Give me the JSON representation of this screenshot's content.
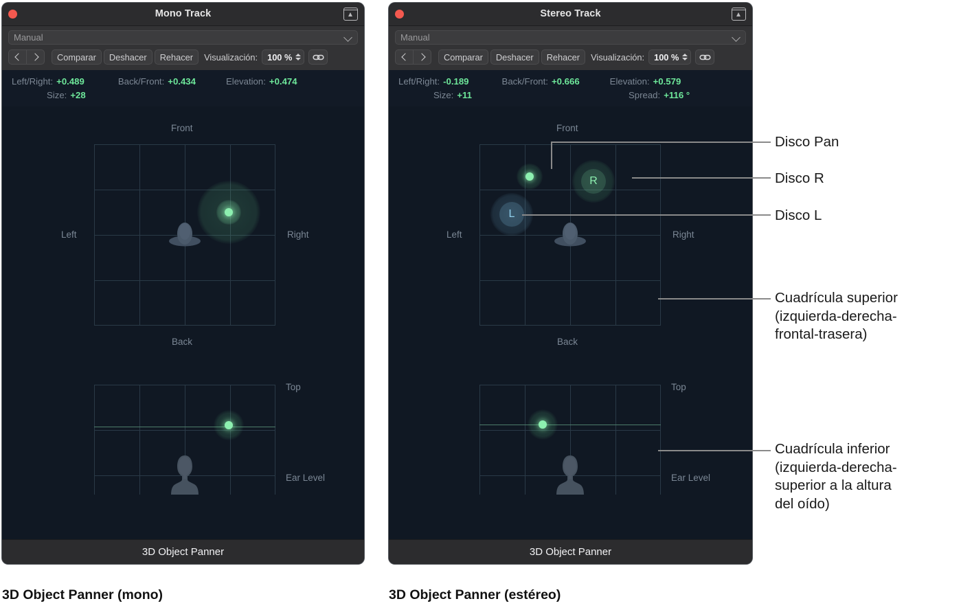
{
  "mono": {
    "title": "Mono Track",
    "preset": "Manual",
    "toolbar": {
      "prev": "‹",
      "next": "›",
      "compare": "Comparar",
      "undo": "Deshacer",
      "redo": "Rehacer",
      "view_label": "Visualización:",
      "zoom_value": "100 %",
      "link_icon": "link-icon"
    },
    "readout": {
      "left_right_label": "Left/Right:",
      "left_right_value": "+0.489",
      "back_front_label": "Back/Front:",
      "back_front_value": "+0.434",
      "elevation_label": "Elevation:",
      "elevation_value": "+0.474",
      "size_label": "Size:",
      "size_value": "+28"
    },
    "top_grid": {
      "front": "Front",
      "back": "Back",
      "left": "Left",
      "right": "Right"
    },
    "bottom_grid": {
      "top": "Top",
      "ear_level": "Ear Level"
    },
    "footer": "3D Object Panner",
    "caption": "3D Object Panner (mono)"
  },
  "stereo": {
    "title": "Stereo Track",
    "preset": "Manual",
    "toolbar": {
      "prev": "‹",
      "next": "›",
      "compare": "Comparar",
      "undo": "Deshacer",
      "redo": "Rehacer",
      "view_label": "Visualización:",
      "zoom_value": "100 %",
      "link_icon": "link-icon"
    },
    "readout": {
      "left_right_label": "Left/Right:",
      "left_right_value": "-0.189",
      "back_front_label": "Back/Front:",
      "back_front_value": "+0.666",
      "elevation_label": "Elevation:",
      "elevation_value": "+0.579",
      "size_label": "Size:",
      "size_value": "+11",
      "spread_label": "Spread:",
      "spread_value": "+116 °"
    },
    "top_grid": {
      "front": "Front",
      "back": "Back",
      "left": "Left",
      "right": "Right"
    },
    "bottom_grid": {
      "top": "Top",
      "ear_level": "Ear Level"
    },
    "pucks": {
      "left": "L",
      "right": "R"
    },
    "footer": "3D Object Panner",
    "caption": "3D Object Panner (estéreo)"
  },
  "callouts": [
    {
      "id": "disco-pan",
      "text": "Disco Pan"
    },
    {
      "id": "disco-r",
      "text": "Disco R"
    },
    {
      "id": "disco-l",
      "text": "Disco L"
    },
    {
      "id": "cuadricula-superior",
      "text": "Cuadrícula superior\n(izquierda-derecha-\nfrontal-trasera)"
    },
    {
      "id": "cuadricula-inferior",
      "text": "Cuadrícula inferior\n(izquierda-derecha-\nsuperior a la altura\ndel oído)"
    }
  ],
  "colors": {
    "accent_green": "#6ee79a",
    "puck_blue": "#7fc6e8",
    "window_bg": "#101823",
    "toolbar_bg": "#333335",
    "titlebar_bg": "#2c2c2e",
    "close_red": "#f4594f",
    "grid_line": "#2a3a47"
  }
}
